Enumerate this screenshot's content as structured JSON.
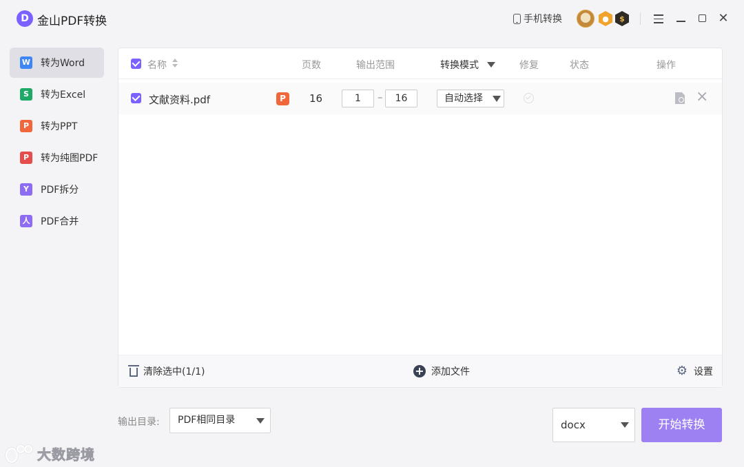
{
  "app": {
    "logo_letter": "D",
    "title": "金山PDF转换"
  },
  "titlebar": {
    "mobile_convert": "手机转换",
    "badge_dark": "$"
  },
  "sidebar": {
    "items": [
      {
        "label": "转为Word",
        "icon": "W",
        "color": "#3e86f5"
      },
      {
        "label": "转为Excel",
        "icon": "S",
        "color": "#1fa866"
      },
      {
        "label": "转为PPT",
        "icon": "P",
        "color": "#f0673c"
      },
      {
        "label": "转为纯图PDF",
        "icon": "P",
        "color": "#e54d4d"
      },
      {
        "label": "PDF拆分",
        "icon": "Y",
        "color": "#8c6cf0"
      },
      {
        "label": "PDF合并",
        "icon": "人",
        "color": "#8c6cf0"
      }
    ]
  },
  "table": {
    "headers": {
      "name": "名称",
      "pages": "页数",
      "range": "输出范围",
      "mode": "转换模式",
      "repair": "修复",
      "status": "状态",
      "actions": "操作"
    },
    "rows": [
      {
        "name": "文献资料.pdf",
        "type_icon": "P",
        "pages": "16",
        "range_from": "1",
        "range_to": "16",
        "range_sep": "–",
        "mode": "自动选择"
      }
    ]
  },
  "footer": {
    "clear": "清除选中(1/1)",
    "add_file": "添加文件",
    "settings": "设置"
  },
  "bottom": {
    "output_label": "输出目录:",
    "output_value": "PDF相同目录",
    "format": "docx",
    "start": "开始转换"
  },
  "watermark": {
    "text": "大数跨境"
  },
  "colors": {
    "accent": "#7b61ff",
    "start_button": "#9d80f2"
  }
}
